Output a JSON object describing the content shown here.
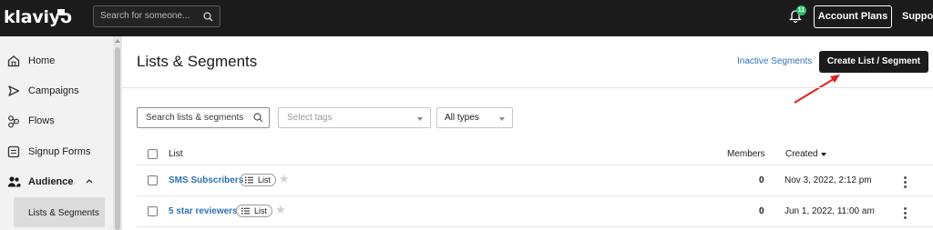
{
  "topbar": {
    "logo": "klaviyo",
    "search_placeholder": "Search for someone...",
    "notification_count": "11",
    "account_plans_label": "Account Plans",
    "support_label": "Support"
  },
  "sidebar": {
    "items": [
      {
        "label": "Home",
        "icon": "home-icon"
      },
      {
        "label": "Campaigns",
        "icon": "send-icon"
      },
      {
        "label": "Flows",
        "icon": "flows-icon"
      },
      {
        "label": "Signup Forms",
        "icon": "form-icon"
      },
      {
        "label": "Audience",
        "icon": "audience-icon"
      }
    ],
    "sub_items": [
      {
        "label": "Lists & Segments"
      }
    ]
  },
  "main": {
    "title": "Lists & Segments",
    "inactive_segments_label": "Inactive Segments",
    "create_button_label": "Create List / Segment",
    "filters": {
      "search_placeholder": "Search lists & segments",
      "tags_placeholder": "Select tags",
      "types_value": "All types"
    },
    "table": {
      "headers": {
        "list": "List",
        "members": "Members",
        "created": "Created"
      },
      "rows": [
        {
          "name": "SMS Subscribers",
          "type": "List",
          "members": "0",
          "created": "Nov 3, 2022, 2:12 pm"
        },
        {
          "name": "5 star reviewers",
          "type": "List",
          "members": "0",
          "created": "Jun 1, 2022, 11:00 am"
        }
      ]
    }
  },
  "colors": {
    "topbar_bg": "#1b1b1b",
    "link_blue": "#2c72b8",
    "annotation_red": "#e02020",
    "badge_green": "#2bbf6a"
  }
}
